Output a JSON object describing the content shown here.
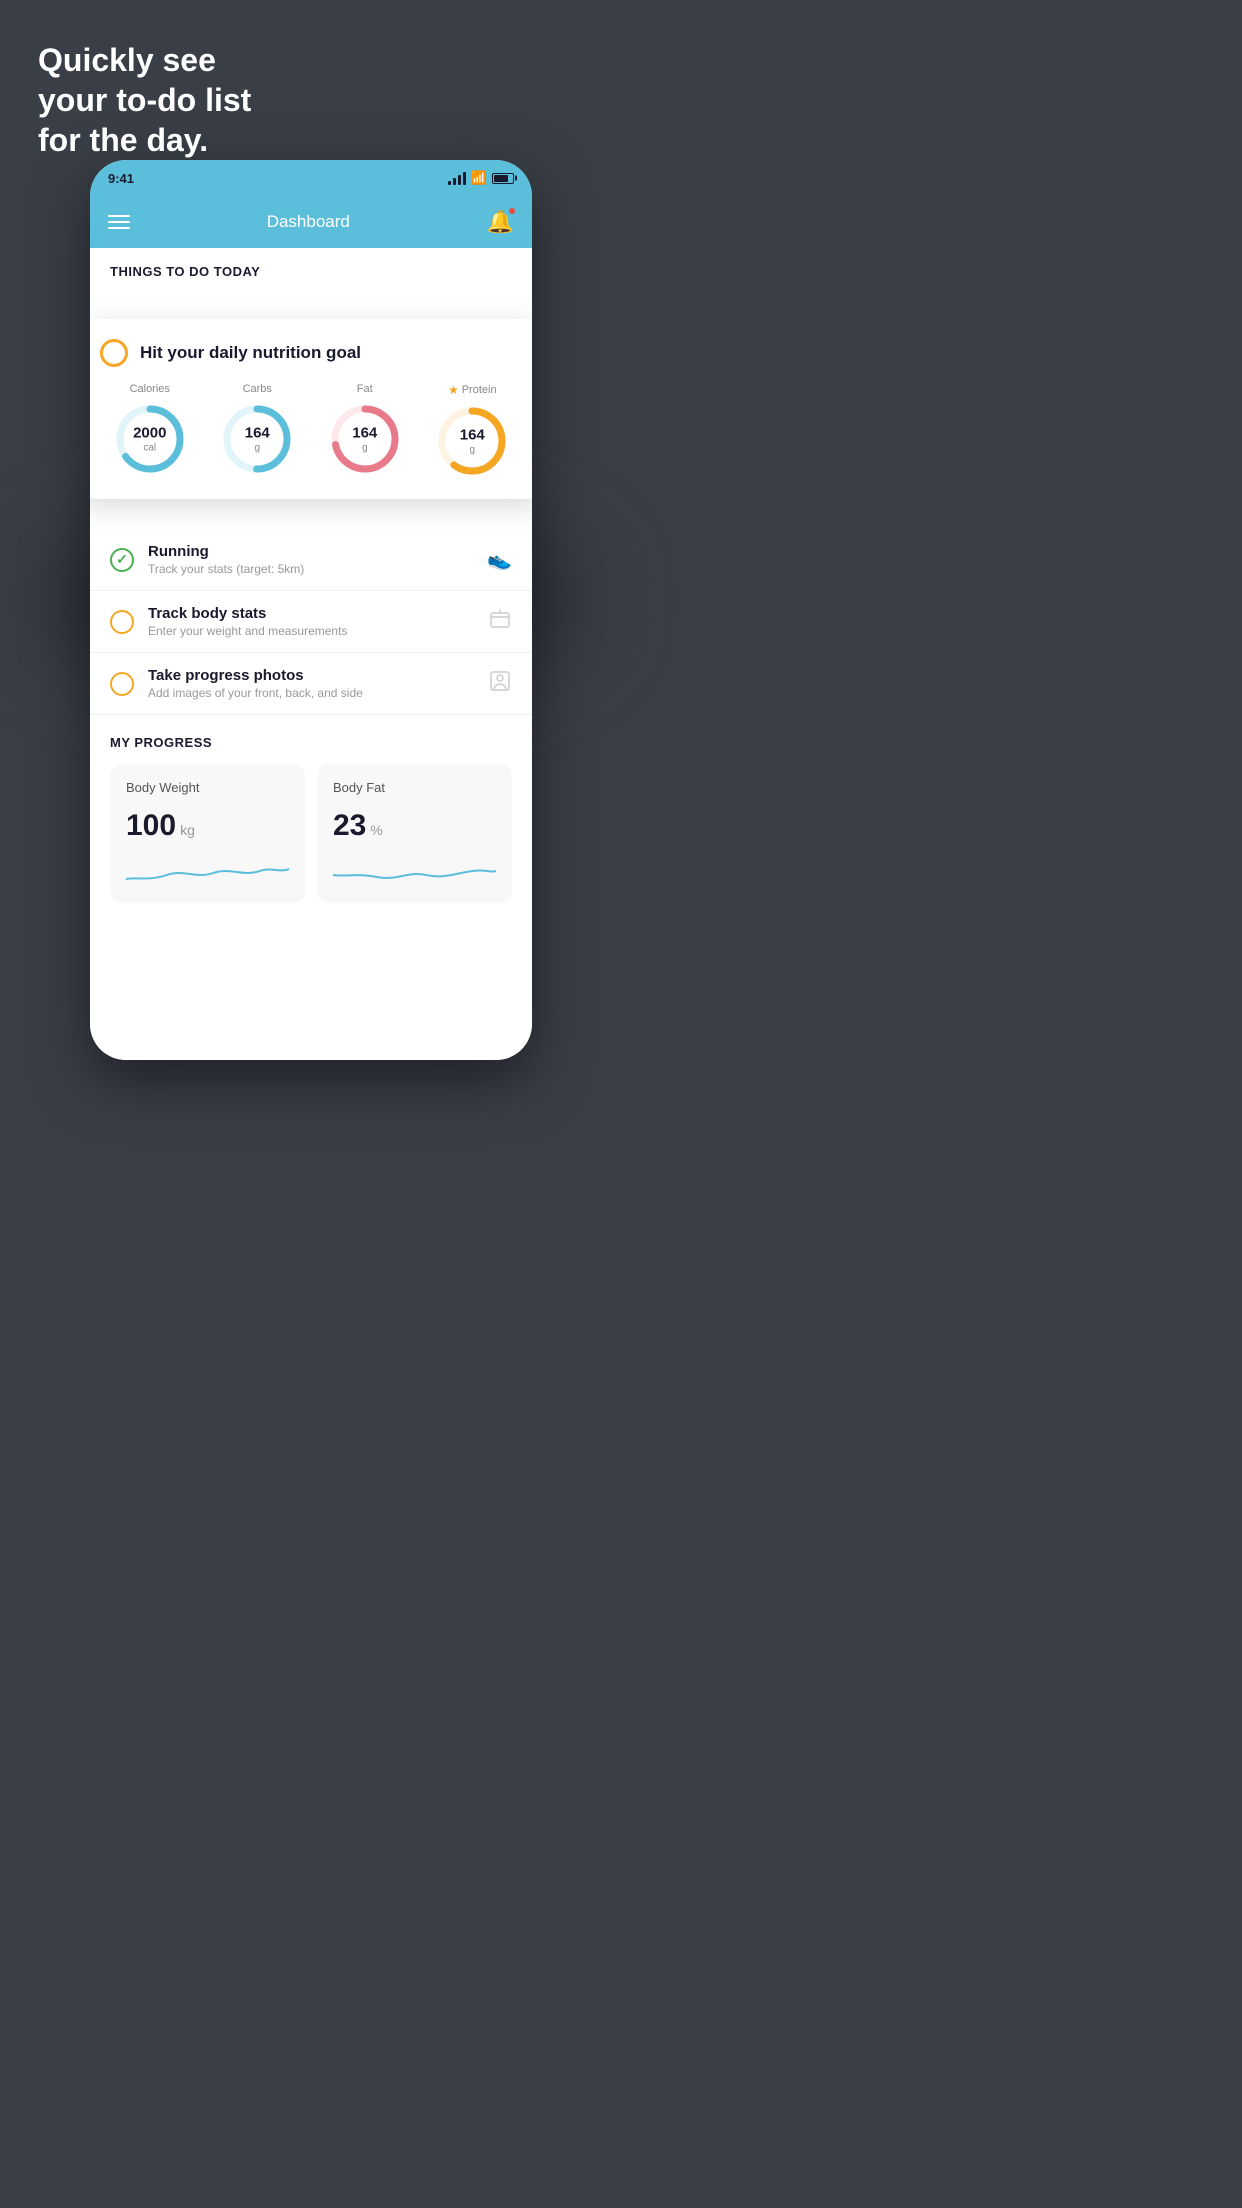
{
  "hero": {
    "line1": "Quickly see",
    "line2": "your to-do list",
    "line3": "for the day."
  },
  "status_bar": {
    "time": "9:41"
  },
  "nav": {
    "title": "Dashboard"
  },
  "section_header": "THINGS TO DO TODAY",
  "floating_card": {
    "title": "Hit your daily nutrition goal",
    "items": [
      {
        "label": "Calories",
        "value": "2000",
        "unit": "cal",
        "color": "#5bbfdc",
        "track_color": "#e0f4fa",
        "progress": 0.65,
        "starred": false
      },
      {
        "label": "Carbs",
        "value": "164",
        "unit": "g",
        "color": "#5bbfdc",
        "track_color": "#e0f4fa",
        "progress": 0.5,
        "starred": false
      },
      {
        "label": "Fat",
        "value": "164",
        "unit": "g",
        "color": "#e87a8a",
        "track_color": "#fde8eb",
        "progress": 0.72,
        "starred": false
      },
      {
        "label": "Protein",
        "value": "164",
        "unit": "g",
        "color": "#f5a623",
        "track_color": "#fef3e2",
        "progress": 0.6,
        "starred": true
      }
    ]
  },
  "todo_items": [
    {
      "title": "Running",
      "subtitle": "Track your stats (target: 5km)",
      "circle_color": "green",
      "icon": "shoe"
    },
    {
      "title": "Track body stats",
      "subtitle": "Enter your weight and measurements",
      "circle_color": "yellow",
      "icon": "scale"
    },
    {
      "title": "Take progress photos",
      "subtitle": "Add images of your front, back, and side",
      "circle_color": "yellow",
      "icon": "person"
    }
  ],
  "progress": {
    "section_title": "MY PROGRESS",
    "cards": [
      {
        "title": "Body Weight",
        "value": "100",
        "unit": "kg"
      },
      {
        "title": "Body Fat",
        "value": "23",
        "unit": "%"
      }
    ]
  }
}
